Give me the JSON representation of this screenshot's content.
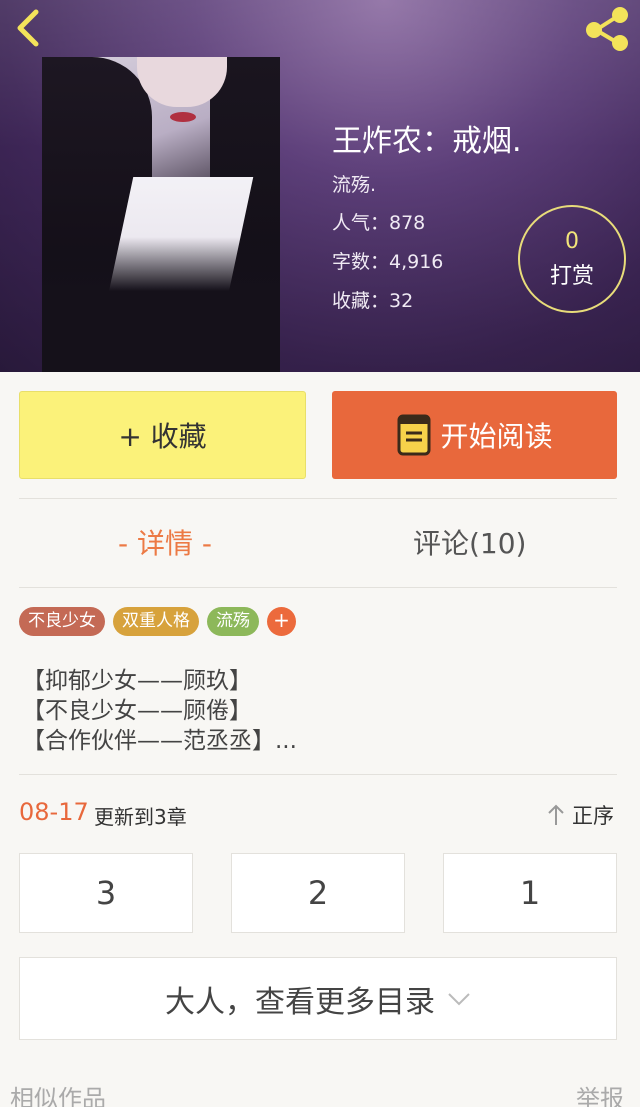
{
  "book": {
    "title": "王炸农：戒烟.",
    "author": "流殇.",
    "popularity": "人气：878",
    "word_count": "字数：4,916",
    "favorites": "收藏：32"
  },
  "reward": {
    "count": "0",
    "label": "打赏"
  },
  "actions": {
    "favorite_label": "+ 收藏",
    "read_label": "开始阅读"
  },
  "tabs": [
    {
      "label": "- 详情 -"
    },
    {
      "label": "评论(10)"
    }
  ],
  "tags": [
    {
      "label": "不良少女",
      "color": "#c46a55"
    },
    {
      "label": "双重人格",
      "color": "#d7a23c"
    },
    {
      "label": "流殇",
      "color": "#8db85a"
    }
  ],
  "add_tag_label": "+",
  "synopsis": [
    "【抑郁少女——顾玖】",
    "【不良少女——顾倦】",
    "【合作伙伴——范丞丞】..."
  ],
  "update": {
    "date": "08-17",
    "text": "更新到3章",
    "sort_label": "正序"
  },
  "chapters": [
    "3",
    "2",
    "1"
  ],
  "more_catalog_label": "大人，查看更多目录",
  "footer": {
    "similar_label": "相似作品",
    "report_label": "举报"
  },
  "colors": {
    "accent": "#e8683c",
    "favorite_bg": "#fbf27a",
    "reward_ring": "#e8dc7a"
  }
}
